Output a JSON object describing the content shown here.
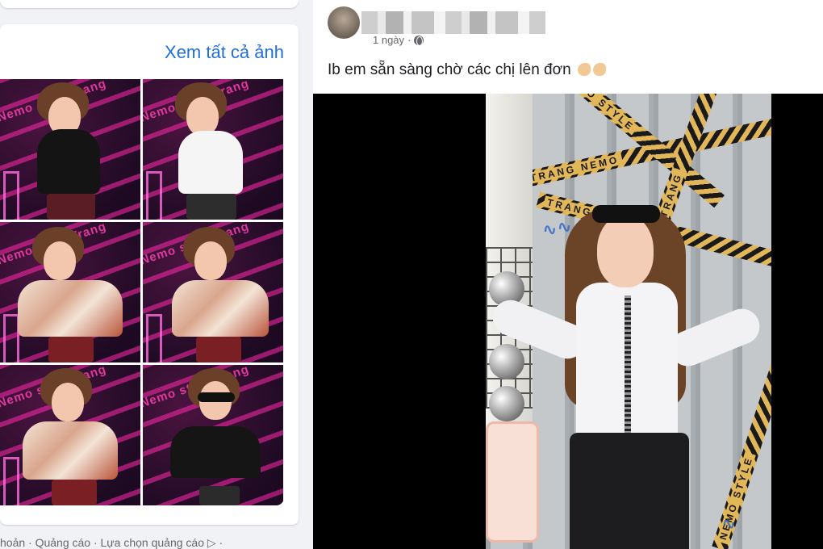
{
  "left": {
    "see_all_label": "Xem tất cả ảnh",
    "tile_watermark": "Nemo style Trang",
    "footer_text": "hoản · Quảng cáo · Lựa chọn quảng cáo ▷ ·"
  },
  "post": {
    "time_label": "1 ngày",
    "separator": "·",
    "text": "Ib em sẵn sàng chờ các chị lên đơn",
    "video": {
      "tape_label_1": "TRANG NEMO",
      "tape_label_2": "NEMO STYLE",
      "tape_label_3": "TRANG",
      "tape_label_4": "TRANG NEMO",
      "tape_label_5": "NEMO STYLE"
    }
  },
  "colors": {
    "link_blue": "#216fdb",
    "page_bg": "#f0f2f5",
    "tape_yellow": "#e1b75a",
    "watermark_pink": "#ff3fb0"
  },
  "icons": [
    "globe-icon",
    "flexed-biceps-emoji",
    "ad-choices-icon"
  ]
}
